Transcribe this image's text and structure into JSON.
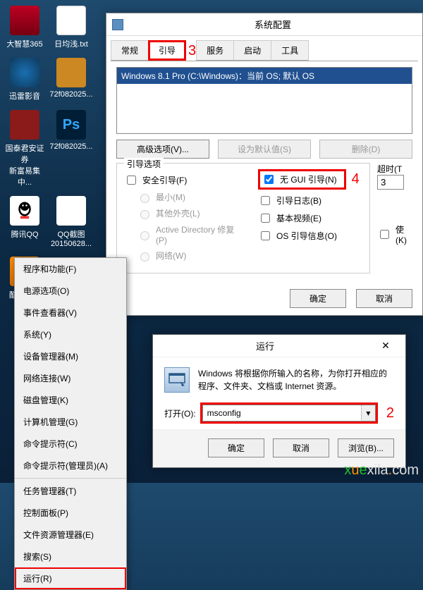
{
  "desktop": {
    "icons": [
      {
        "label": "大智慧365"
      },
      {
        "label": "日均浅.txt"
      },
      {
        "label": "迅雷影音"
      },
      {
        "label": "72f082025..."
      },
      {
        "label": "国泰君安证券\n新富易集中..."
      },
      {
        "label": "72f082025..."
      },
      {
        "label": "腾讯QQ"
      },
      {
        "label": "QQ截图\n20150628..."
      },
      {
        "label": "酷我音乐"
      }
    ]
  },
  "start_menu": {
    "items_top": [
      "程序和功能(F)",
      "电源选项(O)",
      "事件查看器(V)",
      "系统(Y)",
      "设备管理器(M)",
      "网络连接(W)",
      "磁盘管理(K)",
      "计算机管理(G)",
      "命令提示符(C)",
      "命令提示符(管理员)(A)"
    ],
    "items_bottom": [
      "任务管理器(T)",
      "控制面板(P)",
      "文件资源管理器(E)",
      "搜索(S)"
    ],
    "run": "运行(R)"
  },
  "msconfig": {
    "title": "系统配置",
    "tabs": [
      "常规",
      "引导",
      "服务",
      "启动",
      "工具"
    ],
    "marker3": "3",
    "boot_entry": "Windows 8.1 Pro (C:\\Windows)：当前 OS; 默认 OS",
    "adv": "高级选项(V)...",
    "setdef": "设为默认值(S)",
    "del": "删除(D)",
    "group_title": "引导选项",
    "safeboot": "安全引导(F)",
    "min": "最小(M)",
    "other": "其他外壳(L)",
    "ad": "Active Directory 修复(P)",
    "net": "网络(W)",
    "nogui": "无 GUI 引导(N)",
    "marker4": "4",
    "bootlog": "引导日志(B)",
    "basevid": "基本视频(E)",
    "osinfo": "OS 引导信息(O)",
    "timeout_label": "超时(T",
    "timeout_val": "3",
    "makeperm": "使\n(K)",
    "ok": "确定",
    "cancel": "取消"
  },
  "run": {
    "title": "运行",
    "desc": "Windows 将根据你所输入的名称，为你打开相应的程序、文件夹、文档或 Internet 资源。",
    "open_label": "打开(O):",
    "value": "msconfig",
    "marker2": "2",
    "ok": "确定",
    "cancel": "取消",
    "browse": "浏览(B)..."
  },
  "watermark": "xuexila.com"
}
